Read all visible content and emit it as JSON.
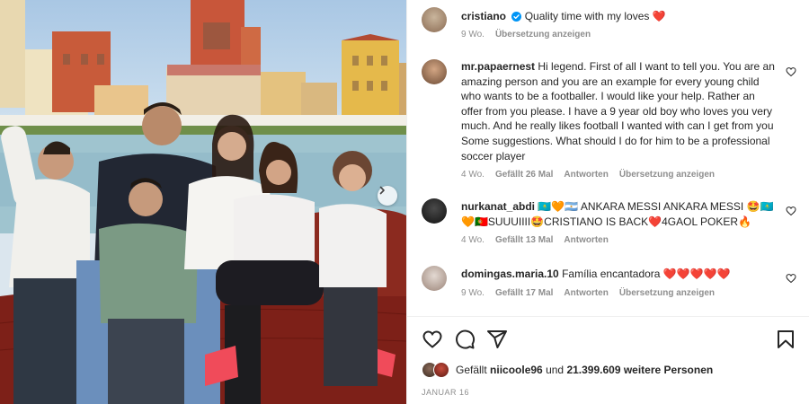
{
  "colors": {
    "accent": "#0095f6",
    "muted": "#8e8e8e",
    "heart": "#ed4956"
  },
  "post": {
    "author": "cristiano",
    "caption": "Quality time with my loves",
    "caption_emoji": "❤️",
    "age": "9 Wo.",
    "translate": "Übersetzung anzeigen"
  },
  "comments": [
    {
      "user": "mr.papaernest",
      "text": "Hi legend. First of all I want to tell you. You are an amazing person and you are an example for every young child who wants to be a footballer. I would like your help. Rather an offer from you please. I have a 9 year old boy who loves you very much. And he really likes football I wanted with can I get from you Some suggestions. What should I do for him to be a professional soccer player",
      "age": "4 Wo.",
      "likes": "Gefällt 26 Mal",
      "reply": "Antworten",
      "translate": "Übersetzung anzeigen"
    },
    {
      "user": "nurkanat_abdi",
      "text": "🇰🇿🧡🇦🇷 ANKARA MESSI ANKARA MESSI 🤩🇰🇿🧡🇵🇹SUUUIIII🤩CRISTIANO IS BACK❤️4GAOL POKER🔥",
      "age": "4 Wo.",
      "likes": "Gefällt 13 Mal",
      "reply": "Antworten"
    },
    {
      "user": "domingas.maria.10",
      "text": "Família encantadora ❤️❤️❤️❤️❤️",
      "age": "9 Wo.",
      "likes": "Gefällt 17 Mal",
      "reply": "Antworten",
      "translate": "Übersetzung anzeigen"
    }
  ],
  "likes_line": {
    "prefix": "Gefällt",
    "user": "niicoole96",
    "middle": "und",
    "count": "21.399.609 weitere Personen"
  },
  "date": "JANUAR 16",
  "icons": [
    "heart-icon",
    "comment-icon",
    "share-icon",
    "bookmark-icon",
    "verified-icon",
    "chevron-right-icon"
  ]
}
